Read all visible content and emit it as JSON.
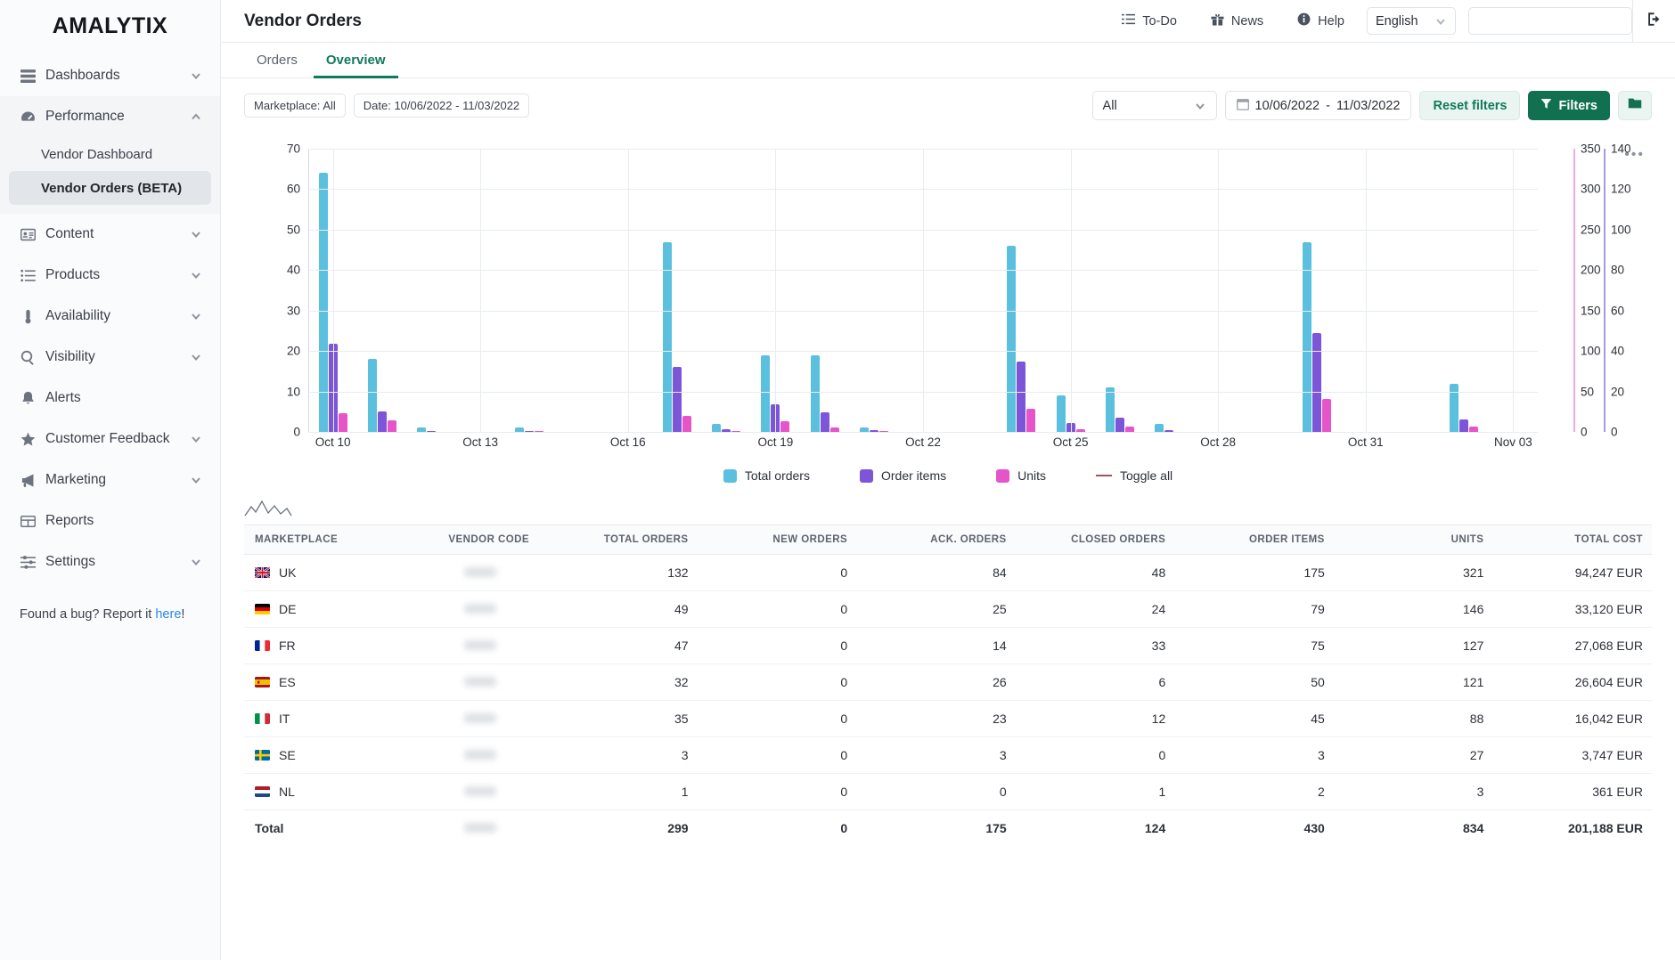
{
  "brand": {
    "name": "AMALYTIX"
  },
  "sidebar": {
    "items": [
      {
        "label": "Dashboards",
        "icon": "dashboards-icon",
        "chevron": "down"
      },
      {
        "label": "Performance",
        "icon": "performance-icon",
        "chevron": "up"
      },
      {
        "label": "Content",
        "icon": "content-icon",
        "chevron": "down"
      },
      {
        "label": "Products",
        "icon": "products-icon",
        "chevron": "down"
      },
      {
        "label": "Availability",
        "icon": "availability-icon",
        "chevron": "down"
      },
      {
        "label": "Visibility",
        "icon": "visibility-icon",
        "chevron": "down"
      },
      {
        "label": "Alerts",
        "icon": "alerts-icon",
        "chevron": "none"
      },
      {
        "label": "Customer Feedback",
        "icon": "customer-feedback-icon",
        "chevron": "down"
      },
      {
        "label": "Marketing",
        "icon": "marketing-icon",
        "chevron": "down"
      },
      {
        "label": "Reports",
        "icon": "reports-icon",
        "chevron": "none"
      },
      {
        "label": "Settings",
        "icon": "settings-icon",
        "chevron": "down"
      }
    ],
    "performance_children": [
      {
        "label": "Vendor Dashboard",
        "active": false
      },
      {
        "label": "Vendor Orders (BETA)",
        "active": true
      }
    ],
    "bug_prefix": "Found a bug? Report it ",
    "bug_link": "here",
    "bug_suffix": "!"
  },
  "header": {
    "title": "Vendor Orders",
    "todo": "To-Do",
    "news": "News",
    "help": "Help",
    "language": "English",
    "search_value": "",
    "search_placeholder": ""
  },
  "tabs": [
    {
      "label": "Orders",
      "active": false
    },
    {
      "label": "Overview",
      "active": true
    }
  ],
  "filters": {
    "chips": [
      "Marketplace: All",
      "Date: 10/06/2022 - 11/03/2022"
    ],
    "marketplace_select": "All",
    "date_from": "10/06/2022",
    "date_separator": "-",
    "date_to": "11/03/2022",
    "reset_label": "Reset filters",
    "filters_label": "Filters",
    "folder_icon": "folder-icon",
    "kebab": "•••"
  },
  "chart_data": {
    "type": "bar",
    "title": "",
    "xlabel": "",
    "ylabel": "",
    "grid": true,
    "legend_position": "bottom",
    "axes": {
      "left": {
        "label": "Total orders",
        "min": 0,
        "max": 70,
        "ticks": [
          0,
          10,
          20,
          30,
          40,
          50,
          60,
          70
        ],
        "color": "#2c3038"
      },
      "right_pink": {
        "label": "Units",
        "min": 0,
        "max": 350,
        "ticks": [
          0,
          50,
          100,
          150,
          200,
          250,
          300,
          350
        ],
        "color": "#f0a8e0"
      },
      "right_purple": {
        "label": "Order items",
        "min": 0,
        "max": 140,
        "ticks": [
          0,
          20,
          40,
          60,
          80,
          100,
          120,
          140
        ],
        "color": "#a79adf"
      }
    },
    "xtick_labels": [
      "Oct 10",
      "Oct 13",
      "Oct 16",
      "Oct 19",
      "Oct 22",
      "Oct 25",
      "Oct 28",
      "Oct 31",
      "Nov 03"
    ],
    "categories": [
      "Oct 10",
      "Oct 11",
      "Oct 12",
      "Oct 13",
      "Oct 14",
      "Oct 15",
      "Oct 16",
      "Oct 17",
      "Oct 18",
      "Oct 19",
      "Oct 20",
      "Oct 21",
      "Oct 22",
      "Oct 23",
      "Oct 24",
      "Oct 25",
      "Oct 26",
      "Oct 27",
      "Oct 28",
      "Oct 29",
      "Oct 30",
      "Oct 31",
      "Nov 01",
      "Nov 02",
      "Nov 03"
    ],
    "series": [
      {
        "name": "Total orders",
        "color": "#5bc0de",
        "axis": "left",
        "values": [
          64,
          18,
          1,
          0,
          1,
          0,
          0,
          47,
          2,
          19,
          19,
          1,
          0,
          0,
          46,
          9,
          11,
          2,
          0,
          0,
          47,
          0,
          0,
          12,
          0
        ]
      },
      {
        "name": "Order items",
        "color": "#7d55d8",
        "axis": "right_purple",
        "values": [
          43.5,
          10,
          0.6,
          0,
          0.6,
          0,
          0,
          32,
          1.2,
          13.5,
          9.5,
          0.8,
          0,
          0,
          35,
          4.5,
          7,
          1,
          0,
          0,
          49,
          0,
          0,
          6,
          0
        ]
      },
      {
        "name": "Units",
        "color": "#e555c9",
        "axis": "right_pink",
        "values": [
          23,
          14.5,
          0.5,
          0,
          1,
          0,
          0,
          19.5,
          1,
          13,
          5,
          1,
          0,
          0,
          28.5,
          3.8,
          7,
          0.4,
          0,
          0,
          41,
          0,
          0,
          6.5,
          0
        ]
      }
    ],
    "legend": [
      {
        "label": "Total orders",
        "color": "#5bc0de",
        "marker": "square"
      },
      {
        "label": "Order items",
        "color": "#7d55d8",
        "marker": "square"
      },
      {
        "label": "Units",
        "color": "#e555c9",
        "marker": "square"
      },
      {
        "label": "Toggle all",
        "color": "#a05262",
        "marker": "dash"
      }
    ]
  },
  "table": {
    "columns": [
      "MARKETPLACE",
      "VENDOR CODE",
      "TOTAL ORDERS",
      "NEW ORDERS",
      "ACK. ORDERS",
      "CLOSED ORDERS",
      "ORDER ITEMS",
      "UNITS",
      "TOTAL COST"
    ],
    "rows": [
      {
        "marketplace": "UK",
        "flag": "flag-uk",
        "vendor_code": "",
        "total_orders": "132",
        "new_orders": "0",
        "ack_orders": "84",
        "closed_orders": "48",
        "order_items": "175",
        "units": "321",
        "total_cost": "94,247 EUR"
      },
      {
        "marketplace": "DE",
        "flag": "flag-de",
        "vendor_code": "",
        "total_orders": "49",
        "new_orders": "0",
        "ack_orders": "25",
        "closed_orders": "24",
        "order_items": "79",
        "units": "146",
        "total_cost": "33,120 EUR"
      },
      {
        "marketplace": "FR",
        "flag": "flag-fr",
        "vendor_code": "",
        "total_orders": "47",
        "new_orders": "0",
        "ack_orders": "14",
        "closed_orders": "33",
        "order_items": "75",
        "units": "127",
        "total_cost": "27,068 EUR"
      },
      {
        "marketplace": "ES",
        "flag": "flag-es",
        "vendor_code": "",
        "total_orders": "32",
        "new_orders": "0",
        "ack_orders": "26",
        "closed_orders": "6",
        "order_items": "50",
        "units": "121",
        "total_cost": "26,604 EUR"
      },
      {
        "marketplace": "IT",
        "flag": "flag-it",
        "vendor_code": "",
        "total_orders": "35",
        "new_orders": "0",
        "ack_orders": "23",
        "closed_orders": "12",
        "order_items": "45",
        "units": "88",
        "total_cost": "16,042 EUR"
      },
      {
        "marketplace": "SE",
        "flag": "flag-se",
        "vendor_code": "",
        "total_orders": "3",
        "new_orders": "0",
        "ack_orders": "3",
        "closed_orders": "0",
        "order_items": "3",
        "units": "27",
        "total_cost": "3,747 EUR"
      },
      {
        "marketplace": "NL",
        "flag": "flag-nl",
        "vendor_code": "",
        "total_orders": "1",
        "new_orders": "0",
        "ack_orders": "0",
        "closed_orders": "1",
        "order_items": "2",
        "units": "3",
        "total_cost": "361 EUR"
      }
    ],
    "total": {
      "marketplace": "Total",
      "flag": "",
      "vendor_code": "",
      "total_orders": "299",
      "new_orders": "0",
      "ack_orders": "175",
      "closed_orders": "124",
      "order_items": "430",
      "units": "834",
      "total_cost": "201,188 EUR"
    }
  }
}
